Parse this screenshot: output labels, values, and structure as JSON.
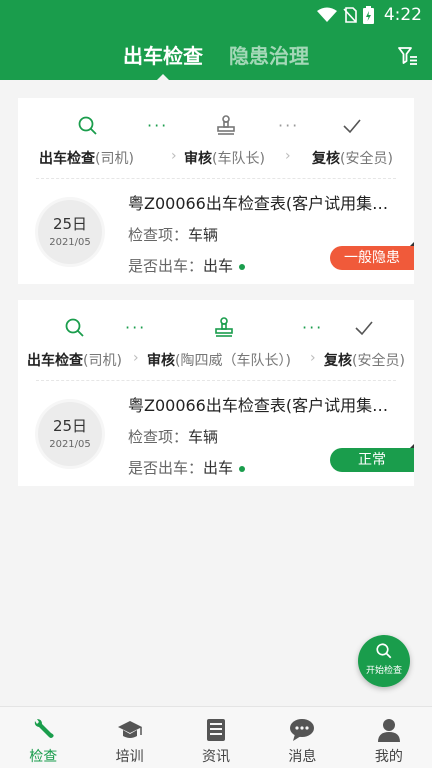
{
  "status_bar": {
    "time": "4:22",
    "icons": [
      "wifi-icon",
      "no-sim-icon",
      "battery-charging-icon"
    ]
  },
  "header": {
    "tabs": [
      {
        "label": "出车检查",
        "active": true
      },
      {
        "label": "隐患治理",
        "active": false
      }
    ],
    "filter_icon": "filter-icon"
  },
  "colors": {
    "primary": "#1a9d4c",
    "danger": "#f05a3a",
    "background": "#f4f4f4"
  },
  "cards": [
    {
      "steps": [
        {
          "icon": "search-icon",
          "bold": "出车检查",
          "role": "(司机)",
          "state": "done"
        },
        {
          "icon": "stamp-icon",
          "bold": "审核",
          "role": "(车队长)",
          "state": "pending"
        },
        {
          "icon": "check-icon",
          "bold": "复核",
          "role": "(安全员)",
          "state": "pending"
        }
      ],
      "date_day": "25日",
      "date_ym": "2021/05",
      "title": "粤Z00066出车检查表(客户试用集…",
      "inspect_label": "检查项：",
      "inspect_value": "车辆",
      "depart_label": "是否出车：",
      "depart_value": "出车",
      "badge": "一般隐患"
    },
    {
      "steps": [
        {
          "icon": "search-icon",
          "bold": "出车检查",
          "role": "(司机)",
          "state": "done"
        },
        {
          "icon": "stamp-icon",
          "bold": "审核",
          "role": "(陶四威（车队长）)",
          "state": "done"
        },
        {
          "icon": "check-icon",
          "bold": "复核",
          "role": "(安全员)",
          "state": "pending"
        }
      ],
      "date_day": "25日",
      "date_ym": "2021/05",
      "title": "粤Z00066出车检查表(客户试用集…",
      "inspect_label": "检查项：",
      "inspect_value": "车辆",
      "depart_label": "是否出车：",
      "depart_value": "出车",
      "badge": "正常"
    }
  ],
  "fab": {
    "label": "开始检查",
    "icon": "search-icon"
  },
  "bottom_nav": [
    {
      "label": "检查",
      "icon": "wrench-icon",
      "active": true
    },
    {
      "label": "培训",
      "icon": "graduation-cap-icon",
      "active": false
    },
    {
      "label": "资讯",
      "icon": "news-icon",
      "active": false
    },
    {
      "label": "消息",
      "icon": "chat-icon",
      "active": false
    },
    {
      "label": "我的",
      "icon": "user-icon",
      "active": false
    }
  ]
}
